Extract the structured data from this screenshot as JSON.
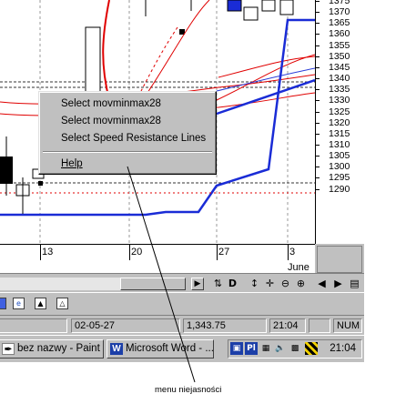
{
  "colors": {
    "price_thick": "#1a2cd6",
    "ma_red": "#e00000",
    "ma_blue": "#2a3cd8",
    "menu_bg": "#c0c0c0"
  },
  "price_axis": {
    "ticks": [
      "1375",
      "1370",
      "1365",
      "1360",
      "1355",
      "1350",
      "1345",
      "1340",
      "1335",
      "1330",
      "1325",
      "1320",
      "1315",
      "1310",
      "1305",
      "1300",
      "1295",
      "1290"
    ]
  },
  "date_axis": {
    "days": [
      "13",
      "20",
      "27",
      "3"
    ],
    "month": "June"
  },
  "context_menu": {
    "items": [
      {
        "label": "Select movminmax28"
      },
      {
        "label": "Select movminmax28"
      },
      {
        "label": "Select Speed Resistance Lines"
      }
    ],
    "help_label": "Help"
  },
  "toolbar": {
    "buttons": [
      "D"
    ]
  },
  "status_bar": {
    "date": "02-05-27",
    "price": "1,343.75",
    "time": "21:04",
    "num": "NUM"
  },
  "taskbar": {
    "tasks": [
      {
        "label": "bez nazwy - Paint",
        "icon": "paint-icon"
      },
      {
        "label": "Microsoft Word - ...",
        "icon": "word-icon"
      }
    ],
    "clock": "21:04"
  },
  "annotation": {
    "text": "menu niejasności"
  }
}
